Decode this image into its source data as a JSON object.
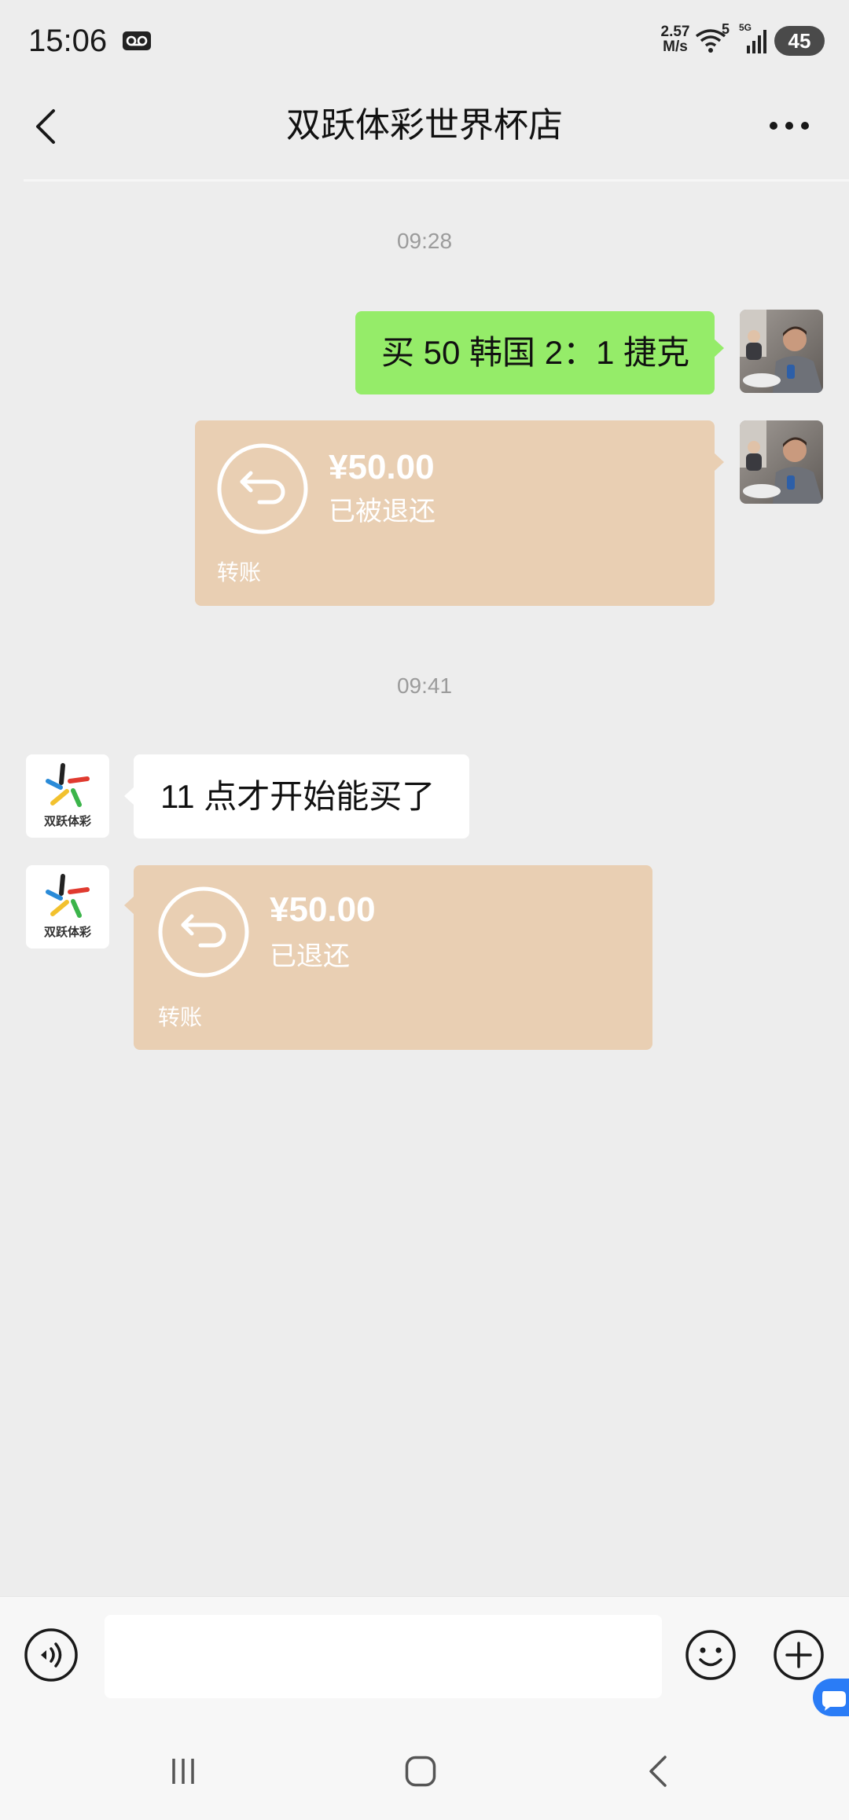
{
  "status_bar": {
    "time": "15:06",
    "net_speed": "2.57",
    "net_speed_unit": "M/s",
    "wifi_badge": "5",
    "signal_badge": "5G",
    "battery_level": "45",
    "icons": {
      "voicemail": "voicemail-icon",
      "wifi": "wifi-icon",
      "signal": "signal-icon",
      "battery": "battery-icon"
    }
  },
  "header": {
    "title": "双跃体彩世界杯店",
    "back_icon": "chevron-left-icon",
    "more_icon": "more-dots-icon"
  },
  "chat": {
    "timestamps": [
      "09:28",
      "09:41"
    ],
    "sent": {
      "text_message": "买 50 韩国 2：1 捷克",
      "transfer": {
        "amount": "¥50.00",
        "status": "已被退还",
        "label": "转账",
        "icon": "refund-arrow-icon"
      },
      "avatar_icon": "user-photo-avatar"
    },
    "received": {
      "text_message": "11 点才开始能买了",
      "transfer": {
        "amount": "¥50.00",
        "status": "已退还",
        "label": "转账",
        "icon": "refund-arrow-icon"
      },
      "avatar_logo_text": "双跃体彩",
      "avatar_icon": "lottery-logo-icon"
    }
  },
  "input_bar": {
    "value": "",
    "placeholder": "",
    "icons": {
      "voice": "voice-icon",
      "emoji": "emoji-icon",
      "plus": "plus-icon",
      "floating": "floating-chat-icon"
    }
  },
  "nav_bar": {
    "icons": {
      "recents": "recents-icon",
      "home": "home-icon",
      "back": "back-icon"
    }
  },
  "colors": {
    "background": "#ededed",
    "sent_bubble": "#95ec69",
    "received_bubble": "#ffffff",
    "refunded_transfer": "#e9cfb3",
    "timestamp_text": "#9b9b9b",
    "floating_button": "#2a7cf6"
  }
}
